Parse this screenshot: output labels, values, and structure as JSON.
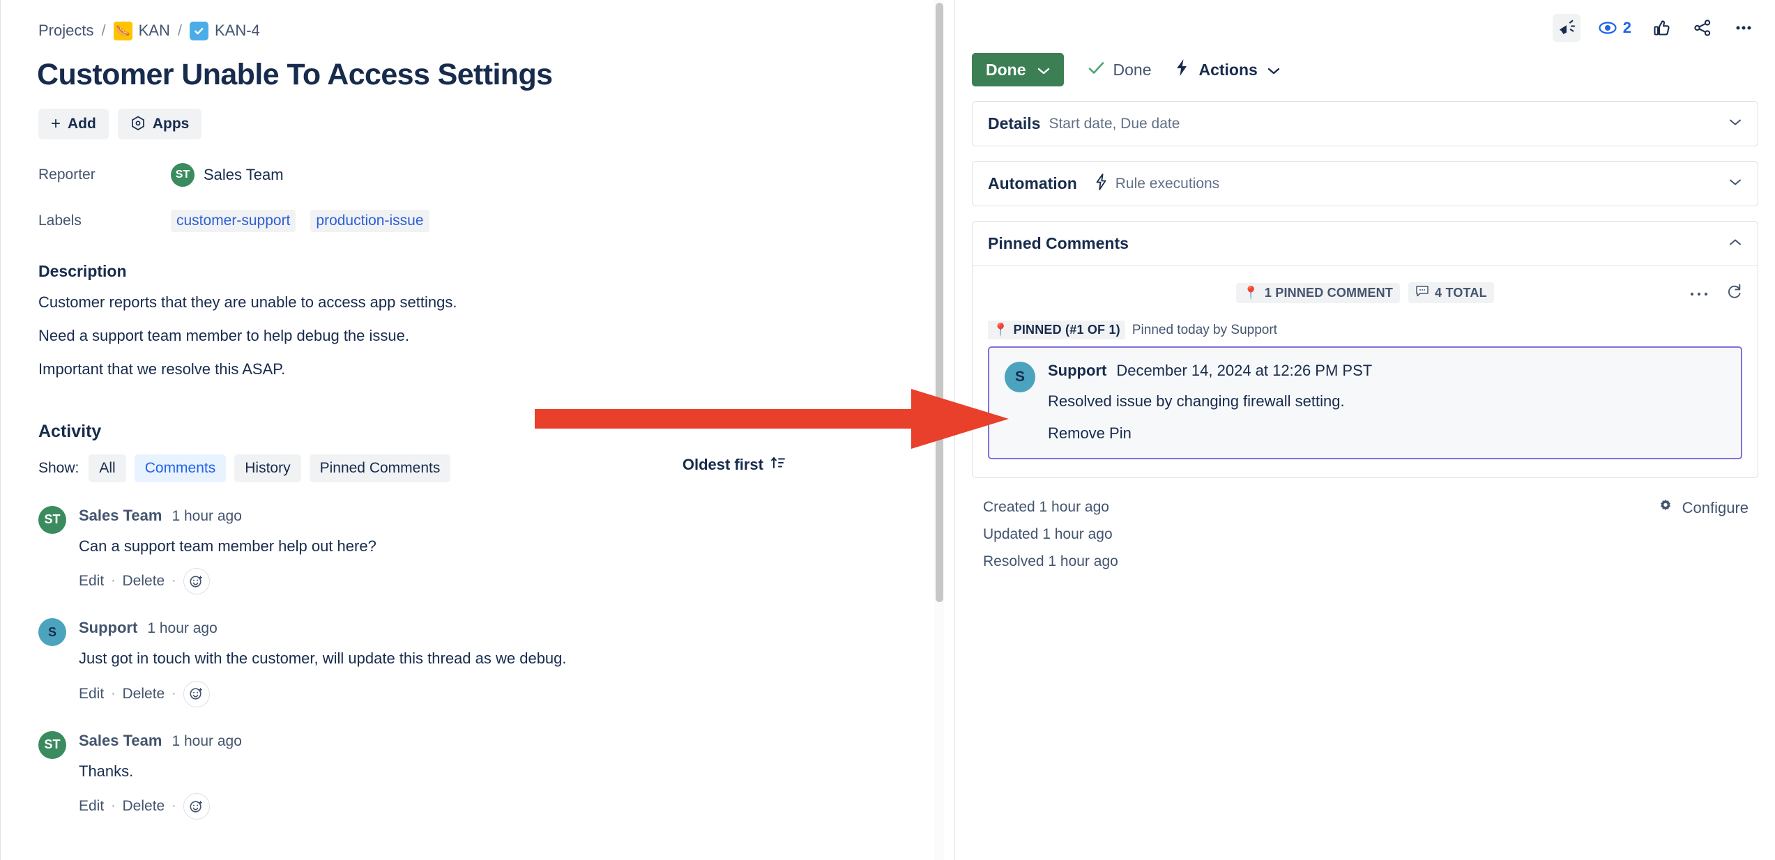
{
  "breadcrumb": {
    "projects": "Projects",
    "sep": "/",
    "project_key": "KAN",
    "project_icon": "hotdog-emoji",
    "issue_key": "KAN-4",
    "issue_type_icon": "task-checkbox-icon"
  },
  "issue": {
    "title": "Customer Unable To Access Settings"
  },
  "toolbar": {
    "add_label": "Add",
    "add_icon": "plus-icon",
    "apps_label": "Apps",
    "apps_icon": "hexagon-apps-icon"
  },
  "fields": {
    "reporter_label": "Reporter",
    "reporter_name": "Sales Team",
    "reporter_initials": "ST",
    "reporter_avatar_color": "#3A8B5E",
    "labels_label": "Labels",
    "labels": [
      "customer-support",
      "production-issue"
    ],
    "label_link_color": "#2C5FD6"
  },
  "description": {
    "heading": "Description",
    "paragraphs": [
      "Customer reports that they are unable to access app settings.",
      "Need a support team member to help debug the issue.",
      "Important that we resolve this ASAP."
    ]
  },
  "activity": {
    "heading": "Activity",
    "show_label": "Show:",
    "tabs": [
      {
        "label": "All",
        "active": false
      },
      {
        "label": "Comments",
        "active": true
      },
      {
        "label": "History",
        "active": false
      },
      {
        "label": "Pinned Comments",
        "active": false
      }
    ],
    "sort_label": "Oldest first",
    "sort_icon": "sort-ascending-icon",
    "comments": [
      {
        "author": "Sales Team",
        "initials": "ST",
        "avatar_color": "#3A8B5E",
        "time": "1 hour ago",
        "text": "Can a support team member help out here?",
        "edit": "Edit",
        "delete": "Delete",
        "emoji_icon": "add-reaction-icon"
      },
      {
        "author": "Support",
        "initials": "S",
        "avatar_color": "#4BA3BD",
        "time": "1 hour ago",
        "text": "Just got in touch with the customer, will update this thread as we debug.",
        "edit": "Edit",
        "delete": "Delete",
        "emoji_icon": "add-reaction-icon"
      },
      {
        "author": "Sales Team",
        "initials": "ST",
        "avatar_color": "#3A8B5E",
        "time": "1 hour ago",
        "text": "Thanks.",
        "edit": "Edit",
        "delete": "Delete",
        "emoji_icon": "add-reaction-icon"
      }
    ]
  },
  "right_panel": {
    "top_icons": [
      {
        "name": "feedback-megaphone-icon",
        "selected": true
      },
      {
        "name": "watch-eye-icon",
        "count": "2"
      },
      {
        "name": "thumbs-up-icon"
      },
      {
        "name": "share-icon"
      },
      {
        "name": "more-options-icon"
      }
    ],
    "watch_count": "2",
    "status_button": "Done",
    "status_button_color": "#3D7F54",
    "status_text": "Done",
    "status_check_icon": "check-icon",
    "actions_label": "Actions",
    "actions_icon": "lightning-bolt-icon",
    "details": {
      "title": "Details",
      "subtitle": "Start date, Due date",
      "chevron": "chevron-down-icon"
    },
    "automation": {
      "title": "Automation",
      "icon": "lightning-bolt-icon",
      "subtitle": "Rule executions",
      "chevron": "chevron-down-icon"
    },
    "pinned_comments": {
      "title": "Pinned Comments",
      "chevron": "chevron-up-icon",
      "stat_pinned": "1 PINNED COMMENT",
      "stat_pinned_icon": "pin-emoji",
      "stat_total": "4 TOTAL",
      "stat_total_icon": "comment-bubble-icon",
      "more_icon": "more-options-icon",
      "refresh_icon": "refresh-icon",
      "pin_badge": "PINNED (#1 OF 1)",
      "pin_badge_icon": "pin-emoji",
      "pin_note": "Pinned today by Support",
      "card_border_color": "#8270DB",
      "comment": {
        "author": "Support",
        "initials": "S",
        "avatar_color": "#4BA3BD",
        "timestamp": "December 14, 2024 at 12:26 PM PST",
        "text": "Resolved issue by changing firewall setting.",
        "remove_label": "Remove Pin"
      }
    },
    "timestamps": [
      "Created 1 hour ago",
      "Updated 1 hour ago",
      "Resolved 1 hour ago"
    ],
    "configure_label": "Configure",
    "configure_icon": "gear-icon"
  },
  "annotation": {
    "arrow_color": "#E8402A",
    "arrow_icon": "right-arrow-annotation"
  }
}
